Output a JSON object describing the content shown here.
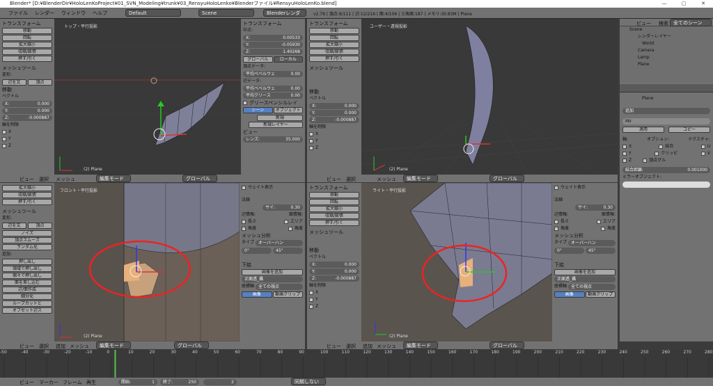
{
  "window": {
    "title": "Blender* [D:¥BlenderDir¥HoloLenKoProject¥01_SVN_Modeling¥trunk¥03_RensyuHoloLenko¥Blenderファイル¥RensyuHoloLenKo.blend]",
    "min": "—",
    "max": "▢",
    "close": "✕"
  },
  "info": {
    "menus": [
      "ファイル",
      "レンダー",
      "ウィンドウ",
      "ヘルプ"
    ],
    "layout": "Default",
    "scene": "Scene",
    "engine": "Blenderレンダー",
    "stats": "v2.79 | 頂点:9/111 | 辺:12/216 | 面:4/106 | 三角面:187 | メモリ:30.83M | Plane"
  },
  "tl": {
    "transform": "トランスフォーム",
    "move": "移動",
    "rotate": "回転",
    "scale": "拡大縮小",
    "shrink": "収縮/膨張",
    "push": "押す/引く",
    "mesh_tools": "メッシュツール",
    "deform": "変形:",
    "slide": "辺を又",
    "vertex": "頂点",
    "move_op": "移動",
    "vector": "ベクトル",
    "x": "X:",
    "y": "Y:",
    "z": "Z:",
    "xv": "0.000",
    "yv": "0.000",
    "zv": "-0.000887",
    "constraint": "軸を制限",
    "cx": "X",
    "cy": "Y",
    "cz": "Z",
    "view_name": "トップ・平行投影",
    "obj": "(2) Plane"
  },
  "np": {
    "transform": "トランスフォーム",
    "median": "中点:",
    "x": "X:",
    "y": "Y:",
    "z": "Z:",
    "xv": "0.00533",
    "yv": "-0.05930",
    "zv": "1.40268",
    "global": "グローバル",
    "local": "ローカル",
    "vdata": "頂点データ:",
    "bevel": "平均ベベルウェ",
    "bevelv": "0.00",
    "edata": "辺データ:",
    "ebevel": "平均ベベルウェ",
    "ebevelv": "0.00",
    "crease": "平均クリース",
    "creasev": "0.00",
    "gpencil": "グリースペンシルレイ",
    "scene": "シーン",
    "object": "オブジェクト",
    "new": "新規",
    "newlayer": "新規レイヤー",
    "view": "ビュー",
    "lens": "レンズ:",
    "lensv": "35.000"
  },
  "tr": {
    "view_name": "ユーザー・透視投影",
    "obj": "(2) Plane"
  },
  "bl": {
    "view_name": "フロント・平行投影",
    "obj": "(2) Plane",
    "items": [
      "拡大縮小",
      "収縮/膨張",
      "押す/引く"
    ],
    "mesh_tools": "メッシュツール",
    "deform": "変形:",
    "slide": "辺を又",
    "vertex": "頂点",
    "noise": "ノイズ",
    "smooth": "頂点スムーズ",
    "random": "ランダム化",
    "add": "追加:",
    "extrude": "押し出し",
    "extrude2": "領域で押し出し",
    "extrude3": "個々で押し出し",
    "inset": "面を差し込む",
    "edge_make": "辺/面作成",
    "subdiv": "細分化",
    "loopcut": "ループカットと",
    "offset": "オフセット辺ス"
  },
  "blnp": {
    "weight": "ウェイト表示",
    "normal": "法線",
    "size": "サイ:",
    "sizev": "0.30",
    "edge_info": "辺情報:",
    "face_info": "面情報:",
    "length": "長さ",
    "area": "エリア",
    "angle": "角度",
    "angle2": "角度",
    "mesh_analysis": "メッシュ分析",
    "type": "タイプ",
    "overhang": "オーバーハン",
    "deg0": "0°",
    "deg45": "45°",
    "bg": "下絵",
    "add_img": "画像を追加",
    "front": "正面透_攝",
    "axis_move": "座標軸",
    "view_all": "全ての視点",
    "image": "画像",
    "movie": "動画クリップ"
  },
  "br": {
    "view_name": "ライト・平行投影",
    "transform": "トランスフォーム",
    "move": "移動",
    "rotate": "回転",
    "scale": "拡大縮小",
    "shrink": "収縮/膨張",
    "push": "押す/引く",
    "mesh_tools": "メッシュツール",
    "move_op": "移動",
    "vector": "ベクトル",
    "x": "X:",
    "y": "Y:",
    "z": "Z:",
    "xv": "0.000",
    "yv": "0.000",
    "zv": "-0.000887",
    "constraint": "軸を制限",
    "cx": "X",
    "cy": "Y",
    "cz": "Z",
    "obj": "(2) Plane"
  },
  "vphdr": {
    "view": "ビュー",
    "select": "選択",
    "mesh": "メッシュ",
    "mode": "編集モード",
    "global": "グローバル",
    "add": "追加"
  },
  "outliner": {
    "view": "ビュー",
    "search": "検索",
    "all": "全てのシーン",
    "scene": "Scene",
    "render_layers": "レンダーレイヤー",
    "world": "World",
    "camera": "Camera",
    "lamp": "Lamp",
    "plane": "Plane"
  },
  "props": {
    "object": "Plane",
    "add_mod": "追加",
    "mod_name": "Mir",
    "apply": "適用",
    "copy": "コピー",
    "axis": "軸:",
    "options": "オプション:",
    "texture": "テクスチャ:",
    "x": "X",
    "y": "Y",
    "z": "Z",
    "merge": "結合",
    "clip": "クリッピ",
    "vgroup": "頂点グル",
    "u": "U",
    "v": "V",
    "merge_dist": "結合距離:",
    "merge_distv": "0.001000",
    "mirror_obj": "ミラーオブジェクト:"
  },
  "timeline": {
    "view": "ビュー",
    "marker": "マーカー",
    "frame": "フレーム",
    "play": "再生",
    "start": "開始:",
    "startv": "1",
    "end": "終了:",
    "endv": "250",
    "cur": "2",
    "sync": "同期しない",
    "ticks": [
      "-50",
      "-40",
      "-30",
      "-20",
      "-10",
      "0",
      "10",
      "20",
      "30",
      "40",
      "50",
      "60",
      "70",
      "80",
      "90",
      "100",
      "110",
      "120",
      "130",
      "140",
      "150",
      "160",
      "170",
      "180",
      "190",
      "200",
      "210",
      "220",
      "230",
      "240",
      "250",
      "260",
      "270",
      "280"
    ]
  }
}
